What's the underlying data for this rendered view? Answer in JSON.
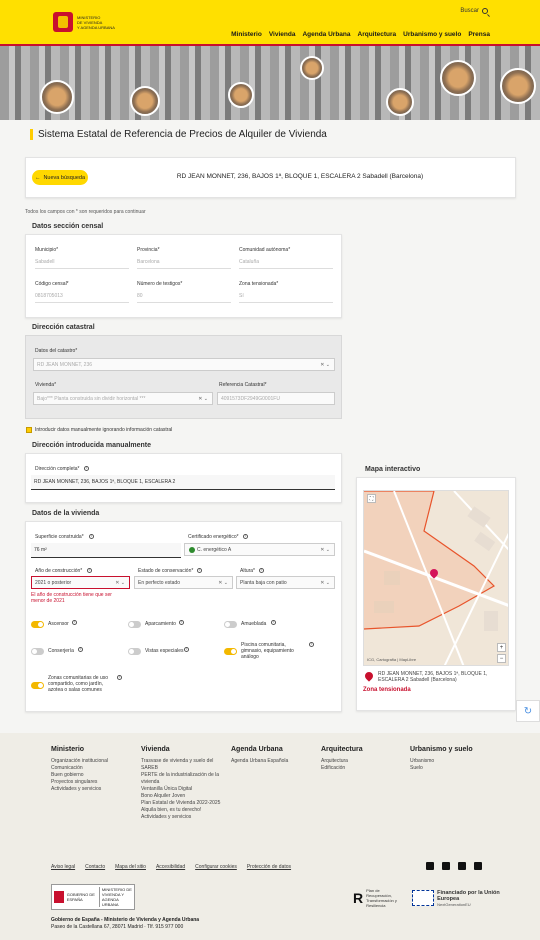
{
  "header": {
    "logo_text": [
      "MINISTERIO",
      "DE VIVIENDA",
      "Y AGENDA URBANA"
    ],
    "search_label": "Buscar",
    "nav": [
      "Ministerio",
      "Vivienda",
      "Agenda Urbana",
      "Arquitectura",
      "Urbanismo y suelo",
      "Prensa"
    ]
  },
  "page_title": "Sistema Estatal de Referencia de Precios de Alquiler de Vivienda",
  "search_card": {
    "new_search_button": "Nueva búsqueda",
    "address": "RD JEAN MONNET, 236, BAJOS 1ª, BLOQUE 1, ESCALERA 2 Sabadell (Barcelona)"
  },
  "required_note": "Todos los campos con * son requeridos para continuar",
  "census": {
    "title": "Datos sección censal",
    "municipio_label": "Municipio*",
    "municipio_value": "Sabadell",
    "provincia_label": "Provincia*",
    "provincia_value": "Barcelona",
    "comunidad_label": "Comunidad autónoma*",
    "comunidad_value": "Cataluña",
    "codigo_label": "Código censal*",
    "codigo_value": "0818705013",
    "testigos_label": "Número de testigos*",
    "testigos_value": "80",
    "zona_label": "Zona tensionada*",
    "zona_value": "Sí"
  },
  "cadastral": {
    "title": "Dirección catastral",
    "datos_label": "Datos del catastro*",
    "datos_value": "RD JEAN MONNET, 236",
    "vivienda_label": "Vivienda*",
    "vivienda_value": "Bajo*** Planta construida sin dividir horizontal ***",
    "referencia_label": "Referencia Catastral*",
    "referencia_value": "4091573DF2949G0001FU"
  },
  "manual_checkbox_label": "Introducir datos manualmente ignorando información catastral",
  "manual": {
    "title": "Dirección introducida manualmente",
    "full_label": "Dirección completa*",
    "full_value": "RD JEAN MONNET, 236, BAJOS 1ª, BLOQUE 1, ESCALERA 2"
  },
  "housing": {
    "title": "Datos de la vivienda",
    "superficie_label": "Superficie construida*",
    "superficie_value": "76  m²",
    "cert_label": "Certificado energético*",
    "cert_value": "C. energético A",
    "anio_label": "Año de construcción*",
    "anio_value": "2021 o posterior",
    "estado_label": "Estado de conservación*",
    "estado_value": "En perfecto estado",
    "altura_label": "Altura*",
    "altura_value": "Planta baja con patio",
    "error_text": "El año de construcción tiene que ser menor de 2021",
    "toggles": [
      {
        "label": "Ascensor",
        "on": true
      },
      {
        "label": "Aparcamiento",
        "on": false
      },
      {
        "label": "Amueblada",
        "on": false
      },
      {
        "label": "Conserjería",
        "on": false
      },
      {
        "label": "Vistas especiales",
        "on": false
      },
      {
        "label": "Piscina comunitaria, gimnasio, equipamiento análogo",
        "on": true
      },
      {
        "label": "Zonas comunitarias de uso compartido, como jardín, azotea o salas comunes",
        "on": true
      }
    ]
  },
  "map": {
    "title": "Mapa interactivo",
    "address": "RD JEAN MONNET, 236, BAJOS 1ª, BLOQUE 1, ESCALERA 2 Sabadell (Barcelona)",
    "zone_label": "Zona tensionada",
    "attribution": "ICG, Cartografia | MapLibre"
  },
  "footer": {
    "columns": [
      {
        "title": "Ministerio",
        "items": [
          "Organización institucional",
          "Comunicación",
          "Buen gobierno",
          "Proyectos singulares",
          "Actividades y servicios"
        ]
      },
      {
        "title": "Vivienda",
        "items": [
          "Trasvase de vivienda y suelo del SAREB",
          "PERTE de la industrialización de la vivienda",
          "Ventanilla Única Digital",
          "Bono Alquiler Joven",
          "Plan Estatal de Vivienda 2022-2025",
          "Alquila bien, es tu derecho!",
          "Actividades y servicios"
        ]
      },
      {
        "title": "Agenda Urbana",
        "items": [
          "Agenda Urbana Española"
        ]
      },
      {
        "title": "Arquitectura",
        "items": [
          "Arquitectura",
          "Edificación"
        ]
      },
      {
        "title": "Urbanismo y suelo",
        "items": [
          "Urbanismo",
          "Suelo"
        ]
      }
    ],
    "links": [
      "Aviso legal",
      "Contacto",
      "Mapa del sitio",
      "Accesibilidad",
      "Configurar cookies",
      "Protección de datos"
    ],
    "gov_box": [
      "GOBIERNO DE ESPAÑA",
      "MINISTERIO DE VIVIENDA Y AGENDA URBANA"
    ],
    "recovery": "Plan de Recuperación, Transformación y Resiliencia",
    "eu": "Financiado por la Unión Europea",
    "eu_sub": "NextGenerationEU",
    "legal_line1": "Gobierno de España - Ministerio de Vivienda y Agenda Urbana",
    "legal_line2": "Paseo de la Castellana 67, 28071 Madrid · Tlf. 915 977 000"
  }
}
